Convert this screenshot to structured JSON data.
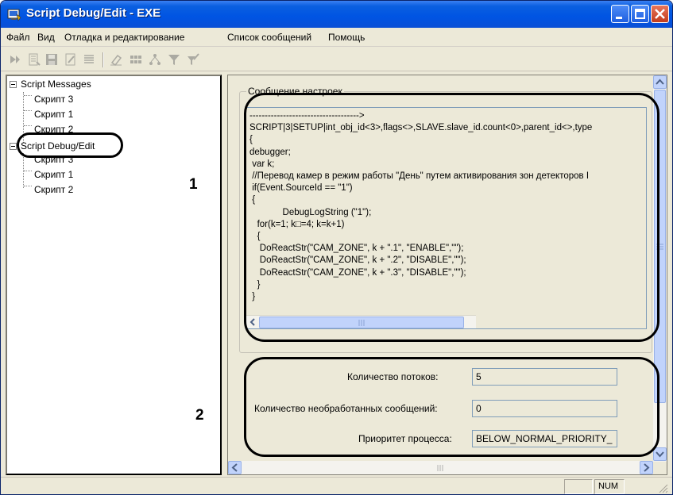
{
  "window": {
    "title": "Script Debug/Edit - EXE"
  },
  "menu": [
    "Файл",
    "Вид",
    "Отладка и редактирование",
    "Список сообщений",
    "Помощь"
  ],
  "toolbar_icons": [
    "step-icon",
    "list-icon",
    "save-icon",
    "edit-icon",
    "lines-icon",
    "eraser-icon",
    "grid-icon",
    "hierarchy-icon",
    "filter-icon",
    "filter-edit-icon"
  ],
  "tree": {
    "groups": [
      {
        "label": "Script Messages",
        "children": [
          "Скрипт 3",
          "Скрипт 1",
          "Скрипт 2"
        ]
      },
      {
        "label": "Script Debug/Edit",
        "children": [
          "Скрипт 3",
          "Скрипт 1",
          "Скрипт 2"
        ]
      }
    ]
  },
  "settings": {
    "legend": "Сообщение настроек",
    "code_lines": [
      "------------------------------------>",
      "SCRIPT|3|SETUP|int_obj_id<3>,flags<>,SLAVE.slave_id.count<0>,parent_id<>,type",
      "{",
      "debugger;",
      " var k;",
      " //Перевод камер в режим работы \"День\" путем активирования зон детекторов I",
      " if(Event.SourceId == \"1\")",
      " {",
      "             DebugLogString (\"1\");",
      "   for(k=1; k□=4; k=k+1)",
      "   {",
      "    DoReactStr(\"CAM_ZONE\", k + \".1\", \"ENABLE\",\"\");",
      "    DoReactStr(\"CAM_ZONE\", k + \".2\", \"DISABLE\",\"\");",
      "    DoReactStr(\"CAM_ZONE\", k + \".3\", \"DISABLE\",\"\");",
      "   }",
      " }"
    ]
  },
  "stats": {
    "threads_label": "Количество потоков:",
    "threads_value": "5",
    "unprocessed_label": "Количество необработанных сообщений:",
    "unprocessed_value": "0",
    "priority_label": "Приоритет процесса:",
    "priority_value": "BELOW_NORMAL_PRIORITY_"
  },
  "annotations": {
    "one": "1",
    "two": "2"
  },
  "status": {
    "num": "NUM"
  }
}
